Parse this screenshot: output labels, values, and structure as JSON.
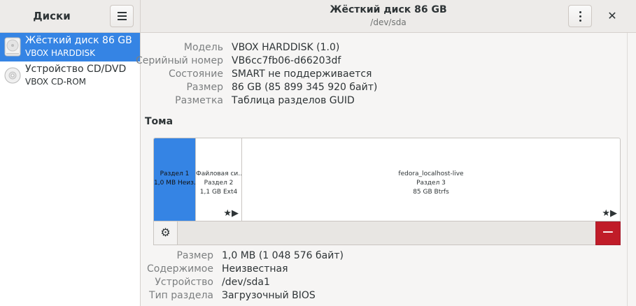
{
  "sidebar": {
    "title": "Диски",
    "items": [
      {
        "name": "Жёсткий диск 86 GB",
        "sub": "VBOX HARDDISK"
      },
      {
        "name": "Устройство CD/DVD",
        "sub": "VBOX CD-ROM"
      }
    ]
  },
  "header": {
    "title": "Жёсткий диск 86 GB",
    "subtitle": "/dev/sda"
  },
  "drive_props": [
    {
      "label": "Модель",
      "value": "VBOX HARDDISK (1.0)"
    },
    {
      "label": "Серийный номер",
      "value": "VB6cc7fb06-d66203df"
    },
    {
      "label": "Состояние",
      "value": "SMART не поддерживается"
    },
    {
      "label": "Размер",
      "value": "86 GB (85 899 345 920 байт)"
    },
    {
      "label": "Разметка",
      "value": "Таблица разделов GUID"
    }
  ],
  "volumes": {
    "heading": "Тома",
    "partitions": [
      {
        "line1": "Раздел 1",
        "line2": "1,0 MB Неиз…",
        "line3": ""
      },
      {
        "line1": "Файловая си…",
        "line2": "Раздел 2",
        "line3": "1,1 GB Ext4"
      },
      {
        "line1": "fedora_localhost-live",
        "line2": "Раздел 3",
        "line3": "85 GB Btrfs"
      }
    ]
  },
  "volume_props": [
    {
      "label": "Размер",
      "value": "1,0 MB (1 048 576 байт)"
    },
    {
      "label": "Содержимое",
      "value": "Неизвестная"
    },
    {
      "label": "Устройство",
      "value": "/dev/sda1"
    },
    {
      "label": "Тип раздела",
      "value": "Загрузочный BIOS"
    }
  ],
  "colors": {
    "accent": "#3584e4",
    "destructive": "#c01c28"
  },
  "icons": {
    "menu": "hamburger-menu-icon",
    "kebab": "vertical-dots-icon",
    "close": "close-icon",
    "gear": "gear-icon",
    "delete": "minus-icon",
    "harddisk": "harddisk-icon",
    "optical": "optical-disc-icon",
    "star": "star-icon",
    "play": "play-icon"
  }
}
